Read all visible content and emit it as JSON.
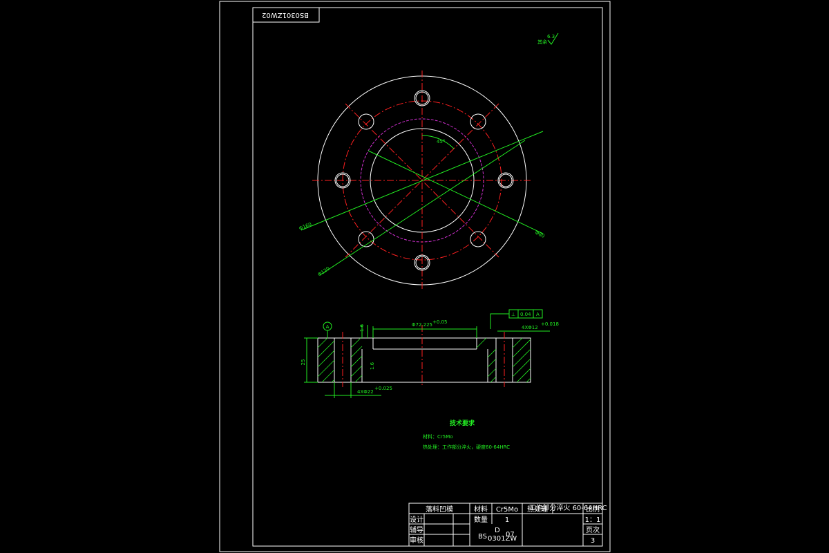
{
  "drawing": {
    "code_stamp": "BS0301ZW02",
    "stamp_sub": "D",
    "surface_finish_note": "其余",
    "surface_finish_value": "6.3",
    "angle_label": "45°",
    "diameter_labels": [
      "Φ160",
      "Φ120",
      "Φ80"
    ]
  },
  "section_view": {
    "datum": "A",
    "top_dim": "Φ72.225",
    "top_dim_tol": "+0.05",
    "fcf_symbol": "⊥",
    "fcf_value": "0.04",
    "fcf_datum": "A",
    "hole_callout_top": "4XΦ12",
    "hole_callout_top_tol": "+0.018",
    "hole_callout_bottom": "4XΦ22",
    "hole_callout_bottom_tol": "+0.025",
    "height_dim": "25",
    "step_dim_a": "1.6",
    "step_dim_b": "1.6"
  },
  "tech_req": {
    "title": "技术要求",
    "line1": "材料：Cr5Mo",
    "line2": "热处理：工作部分淬火，硬度60-64HRC"
  },
  "title_block": {
    "part_name": "落料凹模",
    "material_label": "材料",
    "material_value": "Cr5Mo",
    "heat_label": "热处理",
    "heat_value": "工作部分淬火\n60-64HRC",
    "scale_label": "比例",
    "scale_value": "1：1",
    "qty_label": "数量",
    "qty_value": "1",
    "pages_label": "页次",
    "pages_value": "3",
    "design_label": "设计",
    "guide_label": "辅导",
    "review_label": "审核",
    "drawing_no_main": "BS",
    "drawing_no_sub": "0301ZW",
    "drawing_no_sup": "D",
    "drawing_no_end": "07"
  }
}
